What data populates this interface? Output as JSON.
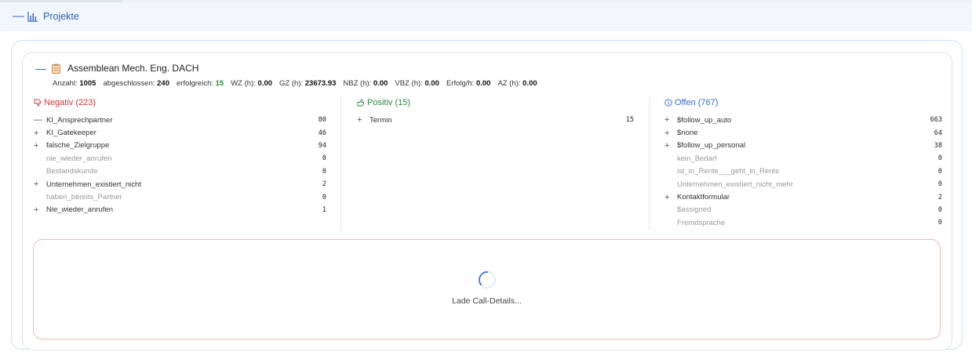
{
  "section": {
    "title": "Projekte",
    "toggle_symbol": "—",
    "icon": "bar-chart-icon"
  },
  "project": {
    "name": "Assemblean Mech. Eng. DACH",
    "toggle_symbol": "—",
    "icon": "clipboard-icon",
    "stats": [
      {
        "label": "Anzahl:",
        "value": "1005",
        "highlight": false
      },
      {
        "label": "abgeschlossen:",
        "value": "240",
        "highlight": false
      },
      {
        "label": "erfolgreich:",
        "value": "15",
        "highlight": true
      },
      {
        "label": "WZ (h):",
        "value": "0.00",
        "highlight": false
      },
      {
        "label": "GZ (h):",
        "value": "23673.93",
        "highlight": false
      },
      {
        "label": "NBZ (h):",
        "value": "0.00",
        "highlight": false
      },
      {
        "label": "VBZ (h):",
        "value": "0.00",
        "highlight": false
      },
      {
        "label": "Erfolg/h:",
        "value": "0.00",
        "highlight": false
      },
      {
        "label": "AZ (h):",
        "value": "0.00",
        "highlight": false
      }
    ]
  },
  "columns": {
    "negativ": {
      "title": "Negativ (223)",
      "icon": "thumbs-down-icon",
      "color": "#d13438",
      "rows": [
        {
          "sign": "—",
          "label": "KI_Ansprechpartner",
          "value": "80",
          "muted": false
        },
        {
          "sign": "+",
          "label": "KI_Gatekeeper",
          "value": "46",
          "muted": false
        },
        {
          "sign": "+",
          "label": "falsche_Zielgruppe",
          "value": "94",
          "muted": false
        },
        {
          "sign": "",
          "label": "nie_wieder_anrufen",
          "value": "0",
          "muted": true
        },
        {
          "sign": "",
          "label": "Bestandskunde",
          "value": "0",
          "muted": true
        },
        {
          "sign": "+",
          "label": "Unternehmen_existiert_nicht",
          "value": "2",
          "muted": false
        },
        {
          "sign": "",
          "label": "haben_bereits_Partner",
          "value": "0",
          "muted": true
        },
        {
          "sign": "+",
          "label": "Nie_wieder_anrufen",
          "value": "1",
          "muted": false
        }
      ]
    },
    "positiv": {
      "title": "Positiv (15)",
      "icon": "thumbs-up-icon",
      "color": "#2b8a3e",
      "rows": [
        {
          "sign": "+",
          "label": "Termin",
          "value": "15",
          "muted": false
        }
      ]
    },
    "offen": {
      "title": "Offen (767)",
      "icon": "info-circle-icon",
      "color": "#2f6bd4",
      "rows": [
        {
          "sign": "+",
          "label": "$follow_up_auto",
          "value": "663",
          "muted": false
        },
        {
          "sign": "+",
          "label": "$none",
          "value": "64",
          "muted": false
        },
        {
          "sign": "+",
          "label": "$follow_up_personal",
          "value": "38",
          "muted": false
        },
        {
          "sign": "",
          "label": "kein_Bedarf",
          "value": "0",
          "muted": true
        },
        {
          "sign": "",
          "label": "ist_in_Rente___geht_in_Rente",
          "value": "0",
          "muted": true
        },
        {
          "sign": "",
          "label": "Unternehmen_existiert_nicht_mehr",
          "value": "0",
          "muted": true
        },
        {
          "sign": "+",
          "label": "Kontaktformular",
          "value": "2",
          "muted": false
        },
        {
          "sign": "",
          "label": "$assigned",
          "value": "0",
          "muted": true
        },
        {
          "sign": "",
          "label": "Fremdsprache",
          "value": "0",
          "muted": true
        }
      ]
    }
  },
  "loading": {
    "text": "Lade Call-Details..."
  }
}
